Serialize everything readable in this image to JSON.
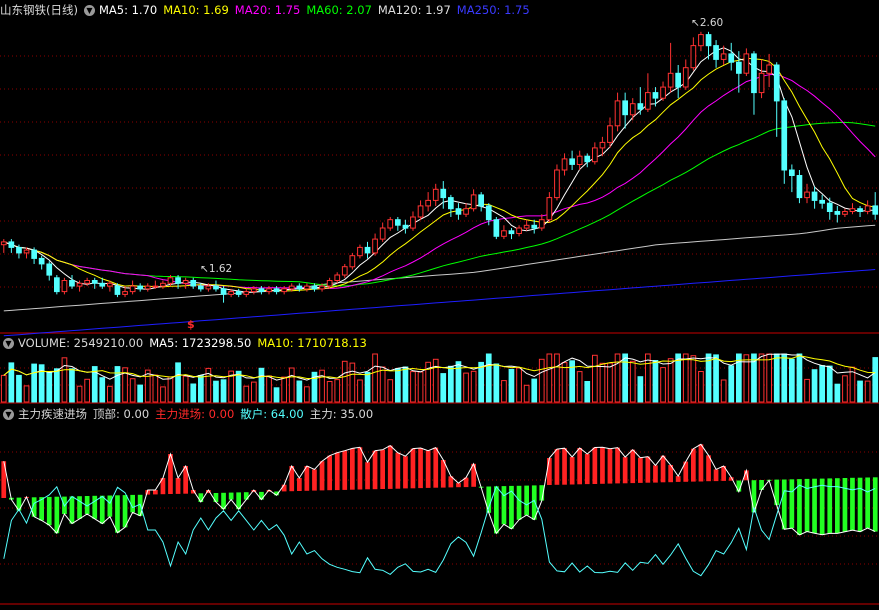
{
  "stock": {
    "name": "山东钢铁",
    "period": "(日线)"
  },
  "colors": {
    "up": "#ff3232",
    "down": "#54ffff",
    "ma5": "#ffffff",
    "ma10": "#ffff00",
    "ma20": "#ff00ff",
    "ma60": "#00ff00",
    "ma120": "#c8c8c8",
    "ma250": "#1e1eff",
    "cyan_line": "#54ffff",
    "green_bar": "#22ff22",
    "red_bar": "#ff2222",
    "grid": "#8b0000",
    "divider": "#a00000"
  },
  "price_legend": {
    "ma5": "MA5: 1.70",
    "ma10": "MA10: 1.69",
    "ma20": "MA20: 1.75",
    "ma60": "MA60: 2.07",
    "ma120": "MA120: 1.97",
    "ma250": "MA250: 1.75"
  },
  "annotations": {
    "high": "2.60",
    "low": "1.62",
    "signal_mark": "$"
  },
  "volume_legend": {
    "volume": "VOLUME: 2549210.00",
    "ma5": "MA5: 1723298.50",
    "ma10": "MA10: 1710718.13"
  },
  "indicator_legend": {
    "name": "主力疾速进场",
    "top": "顶部: 0.00",
    "entry": "主力进场: 0.00",
    "retail": "散户: 64.00",
    "main": "主力: 35.00"
  },
  "chart_data": {
    "type": "candlestick",
    "price_range": [
      1.55,
      2.65
    ],
    "candles": [
      [
        1.83,
        1.84,
        1.8,
        1.85
      ],
      [
        1.84,
        1.82,
        1.8,
        1.85
      ],
      [
        1.82,
        1.8,
        1.78,
        1.83
      ],
      [
        1.8,
        1.81,
        1.78,
        1.82
      ],
      [
        1.81,
        1.78,
        1.76,
        1.82
      ],
      [
        1.78,
        1.76,
        1.74,
        1.79
      ],
      [
        1.76,
        1.72,
        1.7,
        1.77
      ],
      [
        1.71,
        1.66,
        1.65,
        1.72
      ],
      [
        1.66,
        1.7,
        1.65,
        1.71
      ],
      [
        1.7,
        1.68,
        1.67,
        1.72
      ],
      [
        1.68,
        1.69,
        1.66,
        1.7
      ],
      [
        1.69,
        1.7,
        1.68,
        1.71
      ],
      [
        1.7,
        1.69,
        1.67,
        1.71
      ],
      [
        1.69,
        1.68,
        1.67,
        1.71
      ],
      [
        1.68,
        1.69,
        1.66,
        1.7
      ],
      [
        1.68,
        1.65,
        1.64,
        1.69
      ],
      [
        1.65,
        1.66,
        1.64,
        1.68
      ],
      [
        1.66,
        1.68,
        1.65,
        1.7
      ],
      [
        1.68,
        1.67,
        1.66,
        1.69
      ],
      [
        1.67,
        1.68,
        1.66,
        1.69
      ],
      [
        1.68,
        1.68,
        1.67,
        1.7
      ],
      [
        1.68,
        1.69,
        1.67,
        1.7
      ],
      [
        1.69,
        1.71,
        1.68,
        1.72
      ],
      [
        1.71,
        1.69,
        1.67,
        1.72
      ],
      [
        1.69,
        1.7,
        1.67,
        1.71
      ],
      [
        1.7,
        1.68,
        1.67,
        1.71
      ],
      [
        1.68,
        1.67,
        1.66,
        1.69
      ],
      [
        1.67,
        1.68,
        1.66,
        1.69
      ],
      [
        1.68,
        1.67,
        1.66,
        1.7
      ],
      [
        1.67,
        1.65,
        1.62,
        1.68
      ],
      [
        1.65,
        1.66,
        1.64,
        1.67
      ],
      [
        1.66,
        1.65,
        1.64,
        1.67
      ],
      [
        1.65,
        1.66,
        1.64,
        1.67
      ],
      [
        1.66,
        1.67,
        1.65,
        1.68
      ],
      [
        1.67,
        1.66,
        1.65,
        1.68
      ],
      [
        1.66,
        1.67,
        1.65,
        1.68
      ],
      [
        1.67,
        1.66,
        1.65,
        1.68
      ],
      [
        1.66,
        1.67,
        1.65,
        1.68
      ],
      [
        1.67,
        1.68,
        1.66,
        1.69
      ],
      [
        1.68,
        1.67,
        1.66,
        1.69
      ],
      [
        1.67,
        1.68,
        1.66,
        1.69
      ],
      [
        1.68,
        1.67,
        1.66,
        1.69
      ],
      [
        1.67,
        1.68,
        1.66,
        1.69
      ],
      [
        1.68,
        1.7,
        1.67,
        1.71
      ],
      [
        1.7,
        1.72,
        1.69,
        1.73
      ],
      [
        1.72,
        1.75,
        1.71,
        1.76
      ],
      [
        1.75,
        1.79,
        1.74,
        1.8
      ],
      [
        1.79,
        1.82,
        1.78,
        1.83
      ],
      [
        1.82,
        1.8,
        1.78,
        1.84
      ],
      [
        1.8,
        1.85,
        1.79,
        1.87
      ],
      [
        1.85,
        1.89,
        1.84,
        1.91
      ],
      [
        1.89,
        1.92,
        1.88,
        1.93
      ],
      [
        1.92,
        1.9,
        1.88,
        1.93
      ],
      [
        1.9,
        1.89,
        1.87,
        1.92
      ],
      [
        1.89,
        1.93,
        1.88,
        1.95
      ],
      [
        1.93,
        1.97,
        1.92,
        1.99
      ],
      [
        1.97,
        1.99,
        1.95,
        2.02
      ],
      [
        1.99,
        2.03,
        1.97,
        2.05
      ],
      [
        2.03,
        2.0,
        1.96,
        2.06
      ],
      [
        2.0,
        1.96,
        1.93,
        2.01
      ],
      [
        1.96,
        1.94,
        1.92,
        1.98
      ],
      [
        1.94,
        1.96,
        1.93,
        1.98
      ],
      [
        1.96,
        2.01,
        1.95,
        2.03
      ],
      [
        2.01,
        1.97,
        1.95,
        2.02
      ],
      [
        1.97,
        1.92,
        1.9,
        1.98
      ],
      [
        1.92,
        1.86,
        1.85,
        1.93
      ],
      [
        1.86,
        1.88,
        1.85,
        1.9
      ],
      [
        1.88,
        1.87,
        1.85,
        1.89
      ],
      [
        1.87,
        1.89,
        1.86,
        1.9
      ],
      [
        1.89,
        1.9,
        1.88,
        1.92
      ],
      [
        1.9,
        1.89,
        1.87,
        1.92
      ],
      [
        1.89,
        1.92,
        1.88,
        1.94
      ],
      [
        1.92,
        2.0,
        1.91,
        2.02
      ],
      [
        2.0,
        2.1,
        1.99,
        2.12
      ],
      [
        2.1,
        2.14,
        2.08,
        2.16
      ],
      [
        2.14,
        2.12,
        2.1,
        2.17
      ],
      [
        2.12,
        2.15,
        2.1,
        2.17
      ],
      [
        2.15,
        2.13,
        2.11,
        2.16
      ],
      [
        2.13,
        2.18,
        2.12,
        2.2
      ],
      [
        2.18,
        2.2,
        2.15,
        2.22
      ],
      [
        2.2,
        2.26,
        2.18,
        2.29
      ],
      [
        2.26,
        2.35,
        2.24,
        2.38
      ],
      [
        2.35,
        2.3,
        2.25,
        2.38
      ],
      [
        2.3,
        2.34,
        2.28,
        2.36
      ],
      [
        2.34,
        2.32,
        2.3,
        2.4
      ],
      [
        2.32,
        2.38,
        2.31,
        2.45
      ],
      [
        2.38,
        2.36,
        2.33,
        2.4
      ],
      [
        2.36,
        2.4,
        2.35,
        2.42
      ],
      [
        2.4,
        2.45,
        2.38,
        2.56
      ],
      [
        2.45,
        2.4,
        2.36,
        2.48
      ],
      [
        2.4,
        2.47,
        2.39,
        2.5
      ],
      [
        2.47,
        2.55,
        2.46,
        2.58
      ],
      [
        2.55,
        2.59,
        2.53,
        2.6
      ],
      [
        2.59,
        2.55,
        2.5,
        2.6
      ],
      [
        2.55,
        2.5,
        2.47,
        2.57
      ],
      [
        2.5,
        2.52,
        2.48,
        2.55
      ],
      [
        2.52,
        2.49,
        2.46,
        2.56
      ],
      [
        2.49,
        2.45,
        2.38,
        2.53
      ],
      [
        2.45,
        2.52,
        2.44,
        2.54
      ],
      [
        2.52,
        2.38,
        2.3,
        2.53
      ],
      [
        2.38,
        2.45,
        2.36,
        2.5
      ],
      [
        2.45,
        2.48,
        2.4,
        2.52
      ],
      [
        2.48,
        2.35,
        2.22,
        2.49
      ],
      [
        2.35,
        2.1,
        2.05,
        2.36
      ],
      [
        2.1,
        2.08,
        2.02,
        2.12
      ],
      [
        2.08,
        2.0,
        1.98,
        2.1
      ],
      [
        2.0,
        2.02,
        1.98,
        2.05
      ],
      [
        2.02,
        1.99,
        1.96,
        2.04
      ],
      [
        1.99,
        1.98,
        1.96,
        2.01
      ],
      [
        1.98,
        1.95,
        1.92,
        2.0
      ],
      [
        1.95,
        1.94,
        1.91,
        1.97
      ],
      [
        1.94,
        1.95,
        1.93,
        1.96
      ],
      [
        1.95,
        1.96,
        1.94,
        1.98
      ],
      [
        1.96,
        1.95,
        1.93,
        1.97
      ],
      [
        1.95,
        1.97,
        1.94,
        1.99
      ],
      [
        1.97,
        1.94,
        1.92,
        2.02
      ]
    ],
    "ma120": [
      1.59,
      1.6,
      1.61,
      1.62,
      1.63,
      1.64,
      1.65,
      1.66,
      1.67,
      1.69,
      1.7,
      1.71,
      1.72,
      1.73,
      1.75,
      1.77,
      1.79,
      1.81,
      1.83,
      1.84,
      1.85,
      1.86,
      1.87,
      1.89,
      1.9
    ],
    "ma250": [
      1.5,
      1.51,
      1.52,
      1.53,
      1.54,
      1.55,
      1.56,
      1.57,
      1.58,
      1.59,
      1.6,
      1.61,
      1.62,
      1.63,
      1.64,
      1.65,
      1.66,
      1.67,
      1.68,
      1.69,
      1.7,
      1.71,
      1.72,
      1.73,
      1.74
    ]
  }
}
